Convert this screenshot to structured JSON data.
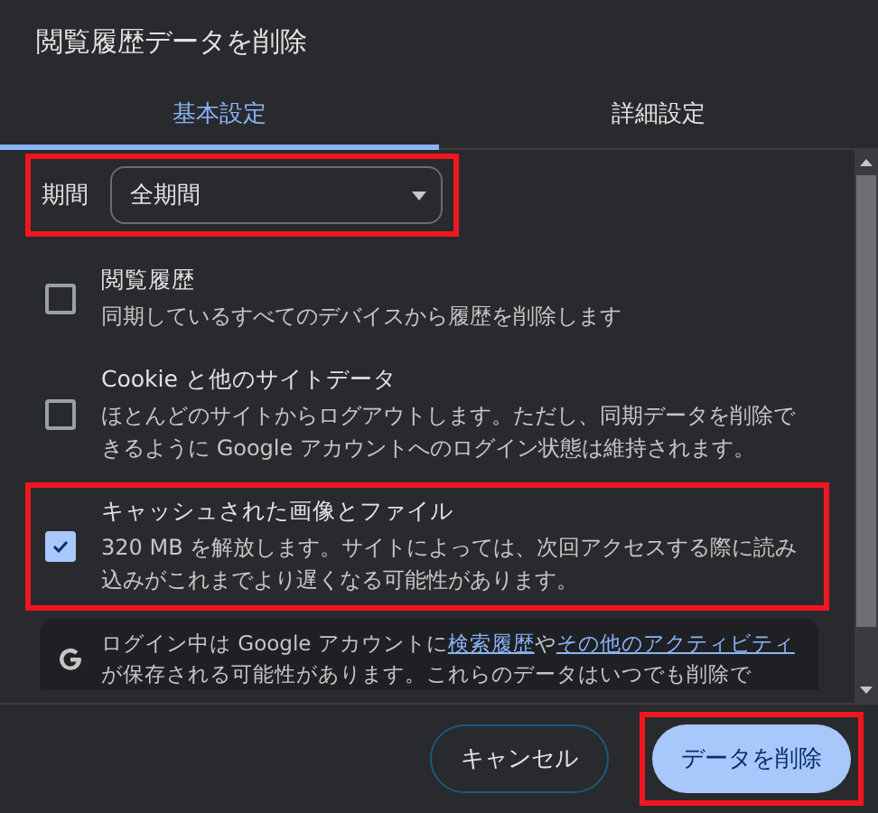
{
  "dialog": {
    "title": "閲覧履歴データを削除"
  },
  "tabs": [
    {
      "label": "基本設定",
      "selected": true
    },
    {
      "label": "詳細設定",
      "selected": false
    }
  ],
  "period": {
    "label": "期間",
    "value": "全期間",
    "highlighted": true
  },
  "items": [
    {
      "title": "閲覧履歴",
      "description": "同期しているすべてのデバイスから履歴を削除します",
      "checked": false,
      "highlighted": false
    },
    {
      "title": "Cookie と他のサイトデータ",
      "description": "ほとんどのサイトからログアウトします。ただし、同期データを削除できるように Google アカウントへのログイン状態は維持されます。",
      "checked": false,
      "highlighted": false
    },
    {
      "title": "キャッシュされた画像とファイル",
      "description": "320 MB を解放します。サイトによっては、次回アクセスする際に読み込みがこれまでより遅くなる可能性があります。",
      "checked": true,
      "highlighted": true
    }
  ],
  "info": {
    "parts": [
      {
        "kind": "text",
        "text": "ログイン中は Google アカウントに"
      },
      {
        "kind": "link",
        "text": "検索履歴"
      },
      {
        "kind": "text",
        "text": "や"
      },
      {
        "kind": "link",
        "text": "その他のアクティビティ"
      },
      {
        "kind": "text",
        "text": "が保存される可能性があります。これらのデータはいつでも削除で"
      }
    ]
  },
  "buttons": [
    {
      "label": "キャンセル",
      "kind": "secondary",
      "highlighted": false
    },
    {
      "label": "データを削除",
      "kind": "primary",
      "highlighted": true
    }
  ]
}
